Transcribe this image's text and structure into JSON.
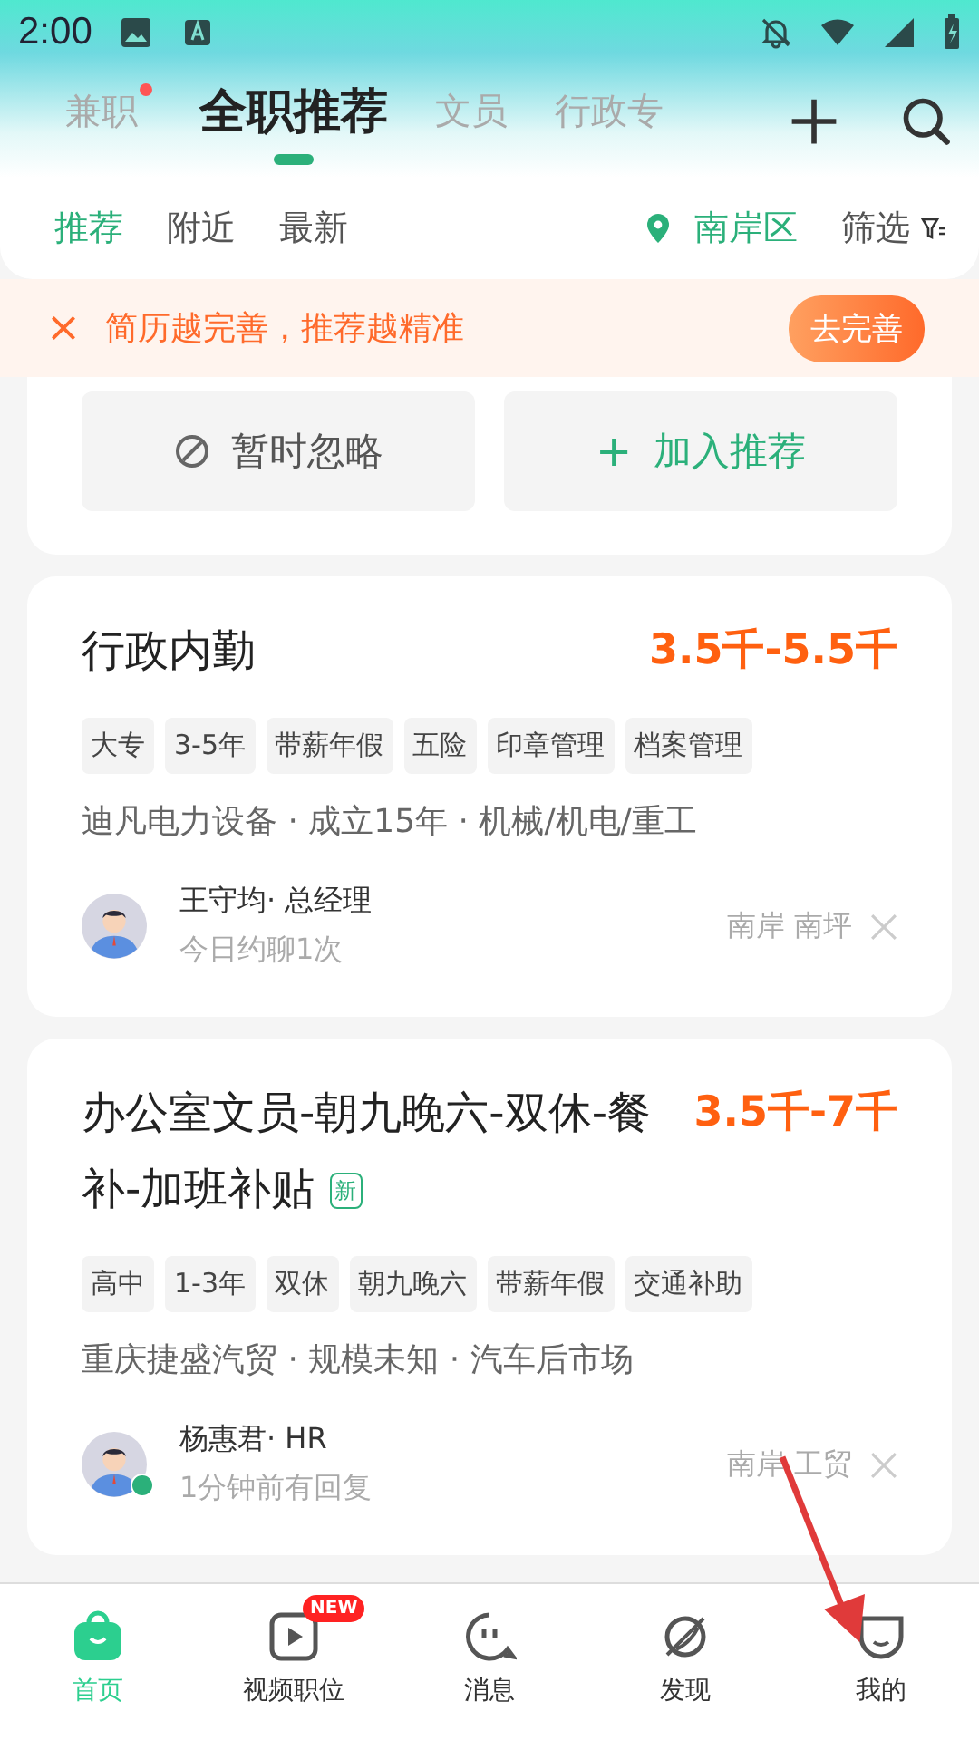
{
  "status_bar": {
    "time": "2:00"
  },
  "top_tabs": [
    {
      "label": "兼职",
      "selected": false,
      "dot": true
    },
    {
      "label": "全职推荐",
      "selected": true,
      "dot": false
    },
    {
      "label": "文员",
      "selected": false,
      "dot": false
    },
    {
      "label": "行政专",
      "selected": false,
      "dot": false
    }
  ],
  "filter_tabs": [
    {
      "label": "推荐",
      "selected": true
    },
    {
      "label": "附近",
      "selected": false
    },
    {
      "label": "最新",
      "selected": false
    }
  ],
  "location": "南岸区",
  "filter": "筛选",
  "banner": {
    "text": "简历越完善，推荐越精准",
    "button": "去完善"
  },
  "card_actions": {
    "ignore": "暂时忽略",
    "add": "加入推荐",
    "add_icon": "+"
  },
  "jobs": [
    {
      "title": "行政内勤",
      "new": false,
      "salary": "3.5千-5.5千",
      "tags": [
        "大专",
        "3-5年",
        "带薪年假",
        "五险",
        "印章管理",
        "档案管理"
      ],
      "company": "迪凡电力设备 · 成立15年 · 机械/机电/重工",
      "recruiter": "王守均· 总经理",
      "activity": "今日约聊1次",
      "online": false,
      "area": "南岸 南坪"
    },
    {
      "title": "办公室文员-朝九晚六-双休-餐补-加班补贴",
      "new": true,
      "new_label": "新",
      "salary": "3.5千-7千",
      "tags": [
        "高中",
        "1-3年",
        "双休",
        "朝九晚六",
        "带薪年假",
        "交通补助"
      ],
      "company": "重庆捷盛汽贸 · 规模未知 · 汽车后市场",
      "recruiter": "杨惠君· HR",
      "activity": "1分钟前有回复",
      "online": true,
      "area": "南岸 工贸"
    }
  ],
  "nav": [
    {
      "label": "首页",
      "kind": "home",
      "selected": true
    },
    {
      "label": "视频职位",
      "kind": "video",
      "selected": false,
      "badge": "NEW"
    },
    {
      "label": "消息",
      "kind": "message",
      "selected": false
    },
    {
      "label": "发现",
      "kind": "discover",
      "selected": false
    },
    {
      "label": "我的",
      "kind": "me",
      "selected": false
    }
  ]
}
